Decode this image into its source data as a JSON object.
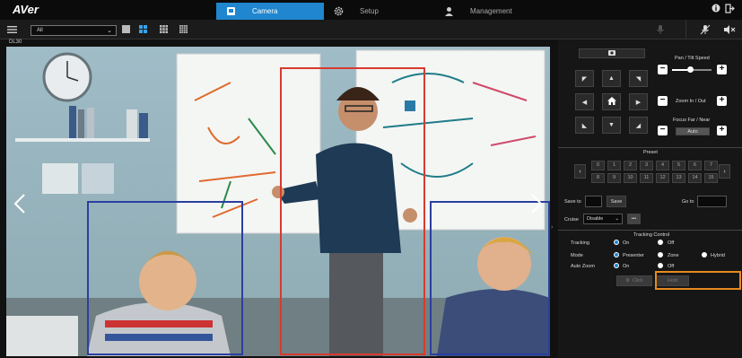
{
  "app": {
    "logo": "AVer"
  },
  "tabs": [
    {
      "label": "Camera",
      "active": true,
      "icon": "camera-icon"
    },
    {
      "label": "Setup",
      "active": false,
      "icon": "gear-icon"
    },
    {
      "label": "Management",
      "active": false,
      "icon": "user-icon"
    }
  ],
  "toolbar": {
    "camera_select": "All"
  },
  "camera_name": "DL30",
  "ptz": {
    "pan_tilt_speed_label": "Pan / Tilt Speed",
    "zoom_label": "Zoom In / Out",
    "focus_label": "Focus Far / Near",
    "focus_mode": "Auto",
    "minus": "−",
    "plus": "+"
  },
  "preset": {
    "title": "Preset",
    "numbers": [
      "0",
      "1",
      "2",
      "3",
      "4",
      "5",
      "6",
      "7",
      "8",
      "9",
      "10",
      "11",
      "12",
      "13",
      "14",
      "15"
    ],
    "save_to_label": "Save to",
    "save_button": "Save",
    "go_to_label": "Go to"
  },
  "cruise": {
    "label": "Cruise",
    "value": "Disable",
    "more": "•••"
  },
  "tracking": {
    "title": "Tracking Control",
    "tracking_label": "Tracking",
    "tracking_on": "On",
    "tracking_off": "Off",
    "mode_label": "Mode",
    "mode_presenter": "Presenter",
    "mode_zone": "Zone",
    "mode_hybrid": "Hybrid",
    "autozoom_label": "Auto Zoom",
    "autozoom_on": "On",
    "autozoom_off": "Off",
    "btn1": "Click",
    "btn2": "Hold"
  },
  "colors": {
    "accent": "#1f86cf",
    "highlight": "#e58a1f",
    "blue_box": "#2a3fa0",
    "red_box": "#d83a2e"
  }
}
